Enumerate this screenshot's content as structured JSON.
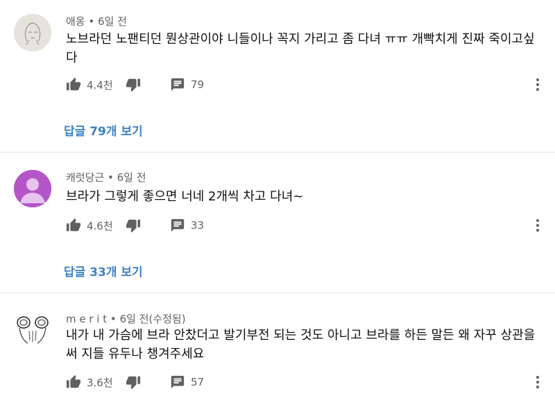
{
  "comments": [
    {
      "author": "애옹",
      "sep": "•",
      "time": "6일 전",
      "edited": "",
      "text": "노브라던 노팬티던 뭔상관이야 니들이나 꼭지 가리고 좀 다녀 ㅠㅠ 개빡치게 진짜 죽이고싶다",
      "likes": "4.4천",
      "reply_count": "79",
      "view_replies": "답글 79개 보기",
      "avatar_icon": "sketch-face-avatar"
    },
    {
      "author": "캐럿당근",
      "sep": "•",
      "time": "6일 전",
      "edited": "",
      "text": "브라가 그렇게 좋으면 너네 2개씩 차고 다녀~",
      "likes": "4.6천",
      "reply_count": "33",
      "view_replies": "답글 33개 보기",
      "avatar_icon": "default-person-avatar",
      "avatar_color": "#b456c8"
    },
    {
      "author": "m e r i t",
      "sep": "•",
      "time": "6일 전",
      "edited": "(수정됨)",
      "text": "내가 내 가슴에 브라 안찼더고 발기부전 되는 것도 아니고 브라를 하든 말든 왜 자꾸 상관을 써 지들 유두나 챙겨주세요",
      "likes": "3.6천",
      "reply_count": "57",
      "view_replies": "",
      "avatar_icon": "cartoon-face-avatar"
    }
  ],
  "colors": {
    "text": "#0f0f0f",
    "meta": "#606060",
    "icon": "#606060",
    "link": "#3e82c4",
    "divider": "#e5e5e5"
  }
}
